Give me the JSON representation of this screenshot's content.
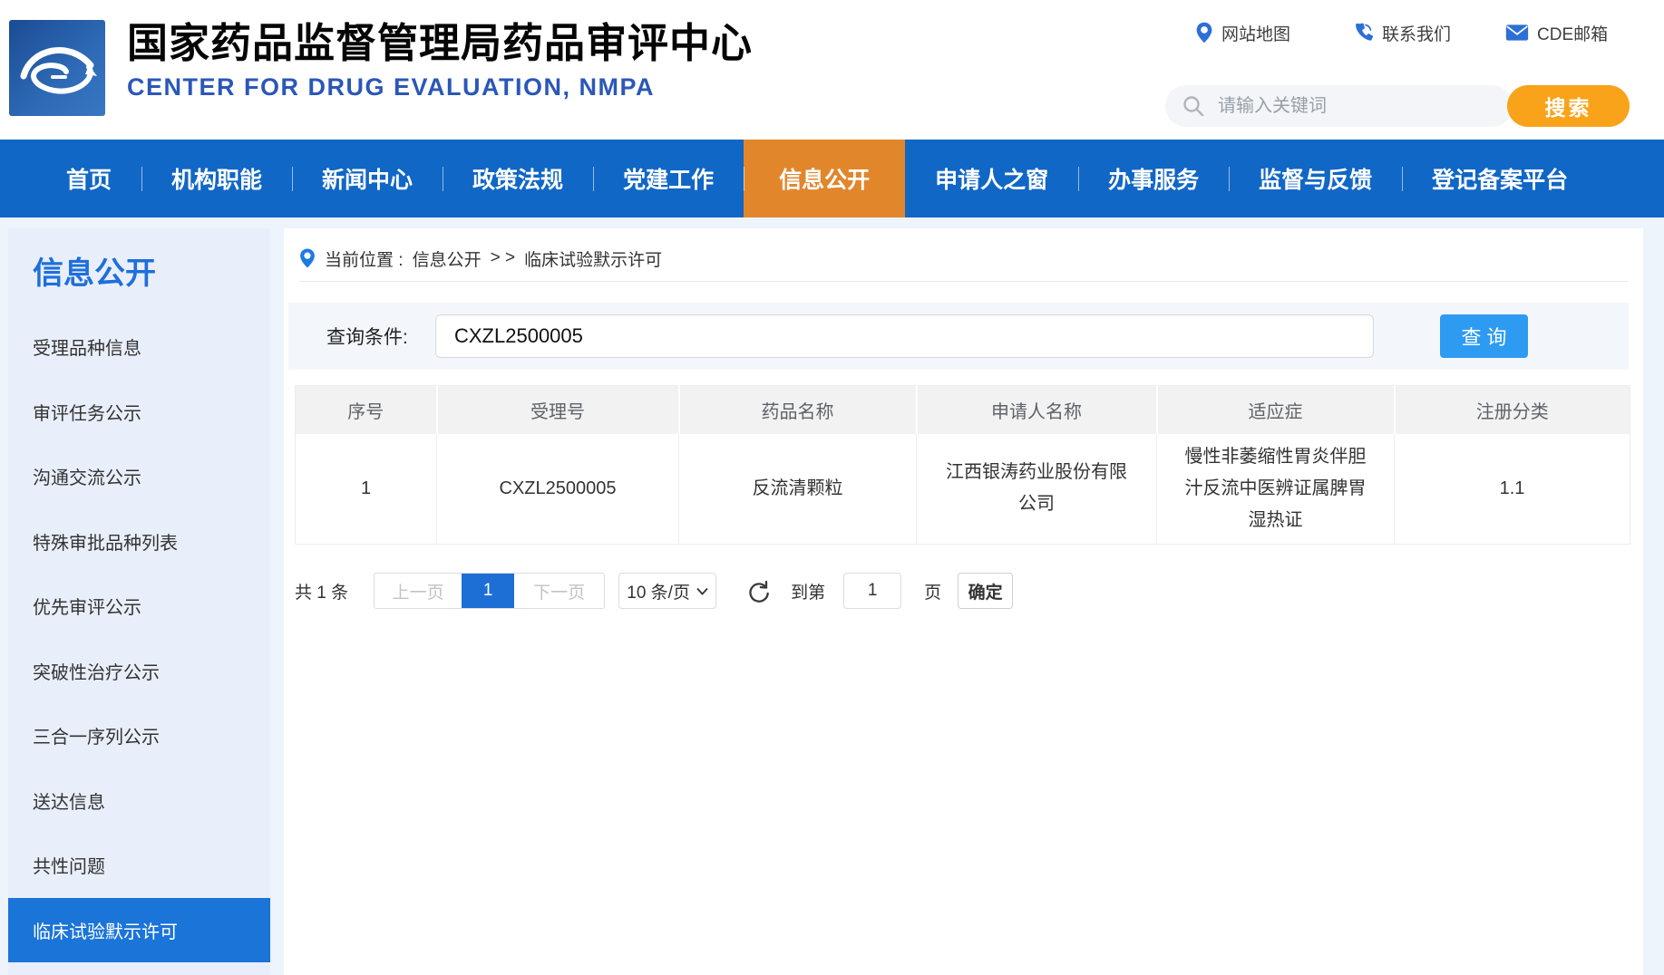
{
  "header": {
    "title": "国家药品监督管理局药品审评中心",
    "subtitle": "CENTER FOR DRUG EVALUATION, NMPA",
    "quick_links": [
      {
        "label": "网站地图",
        "icon": "location-pin-icon"
      },
      {
        "label": "联系我们",
        "icon": "phone-icon"
      },
      {
        "label": "CDE邮箱",
        "icon": "mail-icon"
      }
    ],
    "search": {
      "placeholder": "请输入关键词",
      "button_label": "搜索"
    }
  },
  "nav": {
    "items": [
      {
        "label": "首页",
        "active": false
      },
      {
        "label": "机构职能",
        "active": false
      },
      {
        "label": "新闻中心",
        "active": false
      },
      {
        "label": "政策法规",
        "active": false
      },
      {
        "label": "党建工作",
        "active": false
      },
      {
        "label": "信息公开",
        "active": true
      },
      {
        "label": "申请人之窗",
        "active": false
      },
      {
        "label": "办事服务",
        "active": false
      },
      {
        "label": "监督与反馈",
        "active": false
      },
      {
        "label": "登记备案平台",
        "active": false
      }
    ]
  },
  "sidebar": {
    "title": "信息公开",
    "items": [
      {
        "label": "受理品种信息",
        "active": false
      },
      {
        "label": "审评任务公示",
        "active": false
      },
      {
        "label": "沟通交流公示",
        "active": false
      },
      {
        "label": "特殊审批品种列表",
        "active": false
      },
      {
        "label": "优先审评公示",
        "active": false
      },
      {
        "label": "突破性治疗公示",
        "active": false
      },
      {
        "label": "三合一序列公示",
        "active": false
      },
      {
        "label": "送达信息",
        "active": false
      },
      {
        "label": "共性问题",
        "active": false
      },
      {
        "label": "临床试验默示许可",
        "active": true
      }
    ]
  },
  "breadcrumb": {
    "prefix": "当前位置 :",
    "section": "信息公开",
    "separator": "> >",
    "current": "临床试验默示许可"
  },
  "query": {
    "label": "查询条件:",
    "value": "CXZL2500005",
    "button_label": "查 询"
  },
  "table": {
    "columns": [
      "序号",
      "受理号",
      "药品名称",
      "申请人名称",
      "适应症",
      "注册分类"
    ],
    "rows": [
      [
        "1",
        "CXZL2500005",
        "反流清颗粒",
        "江西银涛药业股份有限公司",
        "慢性非萎缩性胃炎伴胆汁反流中医辨证属脾胃湿热证",
        "1.1"
      ]
    ]
  },
  "pagination": {
    "total": "共 1 条",
    "prev": "上一页",
    "current": "1",
    "next": "下一页",
    "page_size": "10 条/页",
    "goto_label": "到第",
    "goto_value": "1",
    "page_unit": "页",
    "confirm": "确定"
  },
  "colors": {
    "nav_blue": "#1167c5",
    "nav_active_orange": "#e2862c",
    "sidebar_bg": "#e9effa",
    "sidebar_active_blue": "#1b74d8",
    "search_button_orange": "#f9a31a",
    "query_button_blue": "#2e9bf2",
    "pagination_active_blue": "#1d6fd6",
    "subtitle_blue": "#2b57b8",
    "page_bg": "#eef4fc"
  }
}
